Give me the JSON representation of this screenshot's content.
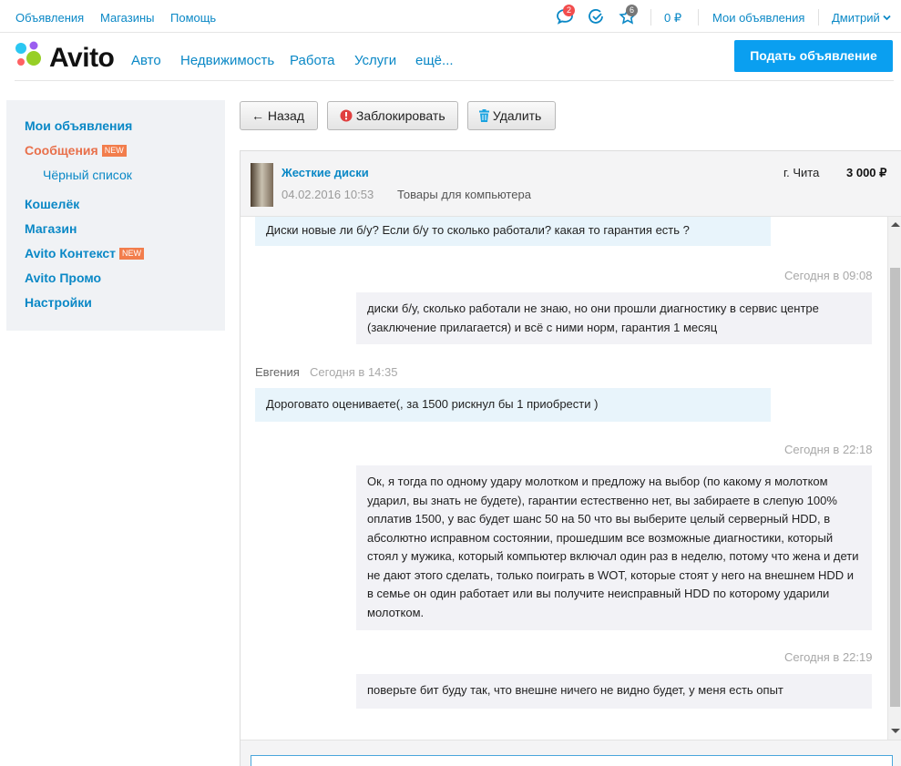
{
  "topbar": {
    "links": [
      "Объявления",
      "Магазины",
      "Помощь"
    ],
    "messages_count": "2",
    "favorites_count": "6",
    "wallet": "0 ₽",
    "my_ads": "Мои объявления",
    "user": "Дмитрий"
  },
  "header": {
    "logo": "Avito",
    "nav": [
      "Авто",
      "Недвижимость",
      "Работа",
      "Услуги",
      "ещё..."
    ],
    "post_button": "Подать объявление"
  },
  "sidebar": {
    "my_ads": "Мои объявления",
    "messages": "Сообщения",
    "new_badge": "NEW",
    "blacklist": "Чёрный список",
    "wallet": "Кошелёк",
    "shop": "Магазин",
    "context": "Avito Контекст",
    "promo": "Avito Промо",
    "settings": "Настройки"
  },
  "actions": {
    "back": "← Назад",
    "block": "Заблокировать",
    "delete": "Удалить"
  },
  "item": {
    "title": "Жесткие диски",
    "date": "04.02.2016 10:53",
    "category": "Товары для компьютера",
    "city": "г. Чита",
    "price": "3 000 ₽"
  },
  "messages": [
    {
      "direction": "in",
      "text": "Диски новые ли б/у? Если б/у то сколько работали? какая то гарантия есть ?"
    },
    {
      "direction": "out",
      "time": "Сегодня в 09:08",
      "text": "диски б/у, сколько работали не знаю, но они прошли диагностику в сервис центре (заключение прилагается) и всё с ними норм, гарантия 1 месяц"
    },
    {
      "direction": "in",
      "sender": "Евгения",
      "time": "Сегодня в 14:35",
      "text": "Дороговато  оцениваете(, за 1500 рискнул бы  1 приобрести )"
    },
    {
      "direction": "out",
      "time": "Сегодня в 22:18",
      "text": "Ок, я тогда по одному удару молотком и предложу на выбор (по какому я молотком ударил, вы знать не будете), гарантии естественно нет, вы забираете в слепую 100% оплатив 1500, у вас будет шанс 50 на 50 что вы выберите целый серверный HDD, в абсолютно исправном состоянии, прошедшим все возможные диагностики, который стоял у мужика, который компьютер включал один раз в неделю, потому что жена и дети не дают этого сделать, только поиграть в WOT, которые стоят у него на внешнем HDD и в семье он один работает или вы получите неисправный HDD по которому ударили молотком."
    },
    {
      "direction": "out",
      "time": "Сегодня в 22:19",
      "text": "поверьте бит буду так, что внешне ничего не видно будет, у меня есть опыт"
    }
  ],
  "colors": {
    "link": "#0a88c6",
    "active": "#e8704b",
    "primary_button": "#0a9ff0",
    "incoming_bubble": "#e8f4fb",
    "outgoing_bubble": "#f2f2f6"
  }
}
